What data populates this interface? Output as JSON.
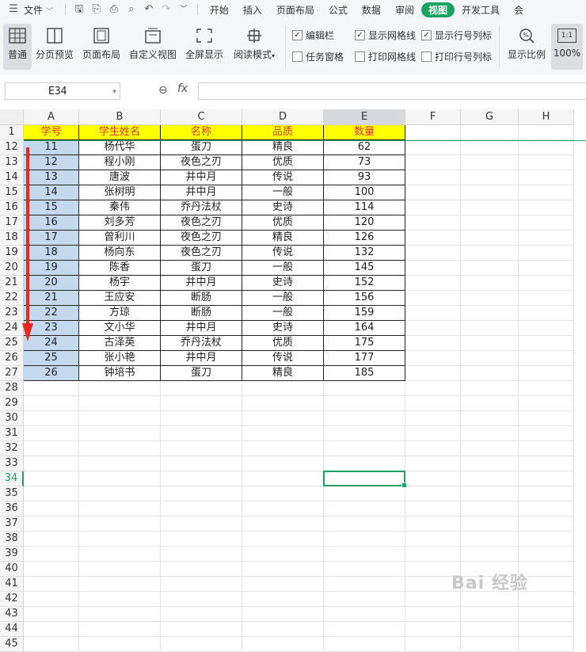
{
  "menubar": {
    "file_label": "文件",
    "tabs": [
      "开始",
      "插入",
      "页面布局",
      "公式",
      "数据",
      "审阅",
      "视图",
      "开发工具",
      "会"
    ],
    "active_tab": "视图"
  },
  "ribbon": {
    "buttons": [
      "普通",
      "分页预览",
      "页面布局",
      "自定义视图",
      "全屏显示",
      "阅读模式",
      "显示比例",
      "100%"
    ],
    "zoom_icon_text": "1:1",
    "checkboxes": [
      {
        "label": "编辑栏",
        "checked": true
      },
      {
        "label": "显示网格线",
        "checked": true
      },
      {
        "label": "显示行号列标",
        "checked": true
      },
      {
        "label": "任务窗格",
        "checked": false
      },
      {
        "label": "打印网格线",
        "checked": false
      },
      {
        "label": "打印行号列标",
        "checked": false
      }
    ]
  },
  "formula_bar": {
    "cell_ref": "E34",
    "fx_label": "fx",
    "formula": ""
  },
  "sheet": {
    "columns": [
      "A",
      "B",
      "C",
      "D",
      "E",
      "F",
      "G",
      "H"
    ],
    "selected_column": "E",
    "header_row_number": "1",
    "headers": [
      "学号",
      "学生姓名",
      "名称",
      "品质",
      "数量"
    ],
    "rows": [
      {
        "n": "12",
        "cells": [
          "11",
          "杨代华",
          "蛋刀",
          "精良",
          "62"
        ]
      },
      {
        "n": "13",
        "cells": [
          "12",
          "程小刚",
          "夜色之刃",
          "优质",
          "73"
        ]
      },
      {
        "n": "14",
        "cells": [
          "13",
          "唐波",
          "井中月",
          "传说",
          "93"
        ]
      },
      {
        "n": "15",
        "cells": [
          "14",
          "张树明",
          "井中月",
          "一般",
          "100"
        ]
      },
      {
        "n": "16",
        "cells": [
          "15",
          "秦伟",
          "乔丹法杖",
          "史诗",
          "114"
        ]
      },
      {
        "n": "17",
        "cells": [
          "16",
          "刘多芳",
          "夜色之刃",
          "优质",
          "120"
        ]
      },
      {
        "n": "18",
        "cells": [
          "17",
          "曾利川",
          "夜色之刃",
          "精良",
          "126"
        ]
      },
      {
        "n": "19",
        "cells": [
          "18",
          "杨向东",
          "夜色之刃",
          "传说",
          "132"
        ]
      },
      {
        "n": "20",
        "cells": [
          "19",
          "陈香",
          "蛋刀",
          "一般",
          "145"
        ]
      },
      {
        "n": "21",
        "cells": [
          "20",
          "杨宇",
          "井中月",
          "史诗",
          "152"
        ]
      },
      {
        "n": "22",
        "cells": [
          "21",
          "王应安",
          "断肠",
          "一般",
          "156"
        ]
      },
      {
        "n": "23",
        "cells": [
          "22",
          "方琼",
          "断肠",
          "一般",
          "159"
        ]
      },
      {
        "n": "24",
        "cells": [
          "23",
          "文小华",
          "井中月",
          "史诗",
          "164"
        ]
      },
      {
        "n": "25",
        "cells": [
          "24",
          "古泽英",
          "乔丹法杖",
          "优质",
          "175"
        ]
      },
      {
        "n": "26",
        "cells": [
          "25",
          "张小艳",
          "井中月",
          "传说",
          "177"
        ]
      },
      {
        "n": "27",
        "cells": [
          "26",
          "钟培书",
          "蛋刀",
          "精良",
          "185"
        ]
      }
    ],
    "empty_row_numbers": [
      "28",
      "29",
      "30",
      "31",
      "32",
      "33",
      "34",
      "35",
      "36",
      "37",
      "38",
      "39",
      "40",
      "41",
      "42",
      "43",
      "44",
      "45"
    ],
    "active_row": "34"
  },
  "watermark": "Bai 经验"
}
